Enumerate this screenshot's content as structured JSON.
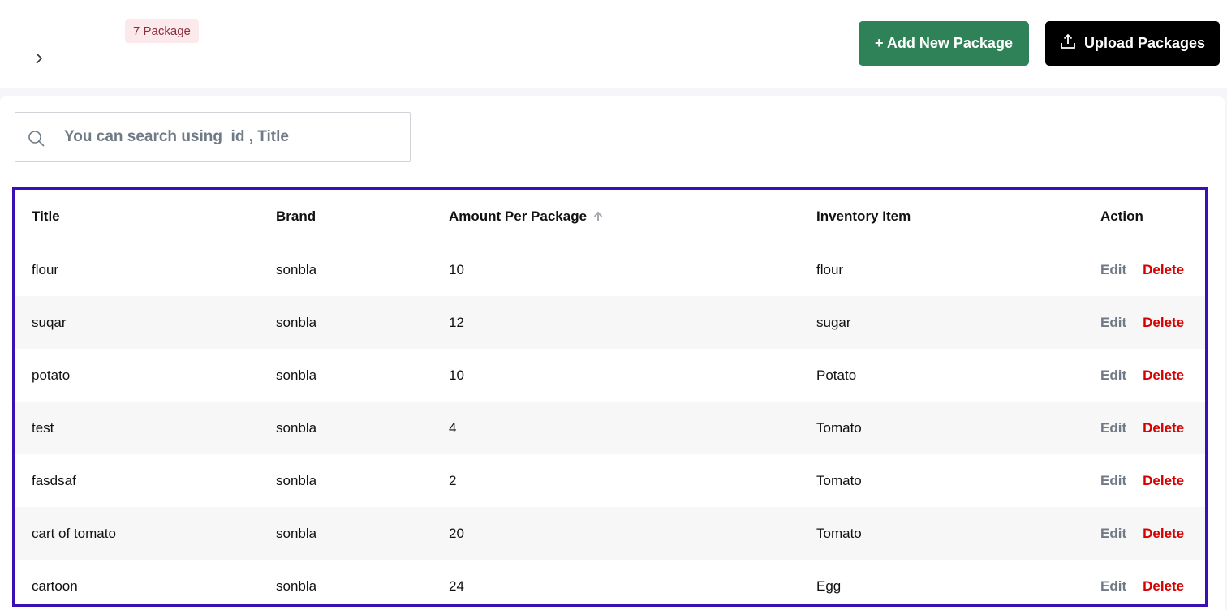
{
  "header": {
    "package_count_badge": "7 Package",
    "add_button_label": "+ Add New Package",
    "upload_button_label": "Upload Packages"
  },
  "search": {
    "placeholder": "You can search using  id , Title"
  },
  "table": {
    "columns": [
      "Title",
      "Brand",
      "Amount Per Package",
      "Inventory Item",
      "Action"
    ],
    "sorted_column": "Amount Per Package",
    "sort_direction": "ascending",
    "action_labels": {
      "edit": "Edit",
      "delete": "Delete"
    },
    "rows": [
      {
        "title": "flour",
        "brand": "sonbla",
        "amount": "10",
        "inventory_item": "flour"
      },
      {
        "title": "suqar",
        "brand": "sonbla",
        "amount": "12",
        "inventory_item": "sugar"
      },
      {
        "title": "potato",
        "brand": "sonbla",
        "amount": "10",
        "inventory_item": "Potato"
      },
      {
        "title": "test",
        "brand": "sonbla",
        "amount": "4",
        "inventory_item": "Tomato"
      },
      {
        "title": "fasdsaf",
        "brand": "sonbla",
        "amount": "2",
        "inventory_item": "Tomato"
      },
      {
        "title": "cart of tomato",
        "brand": "sonbla",
        "amount": "20",
        "inventory_item": "Tomato"
      },
      {
        "title": "cartoon",
        "brand": "sonbla",
        "amount": "24",
        "inventory_item": "Egg"
      }
    ]
  },
  "colors": {
    "add_button": "#2f8157",
    "upload_button": "#000000",
    "badge_bg": "#fbe9ec",
    "badge_text": "#8a2f3c",
    "delete_text": "#d60000",
    "edit_text": "#6f7a86",
    "table_highlight_border": "#3a0fb8"
  },
  "icons": {
    "breadcrumb": "chevron-right-icon",
    "upload": "upload-icon",
    "search": "search-icon",
    "sort": "arrow-up-icon"
  }
}
